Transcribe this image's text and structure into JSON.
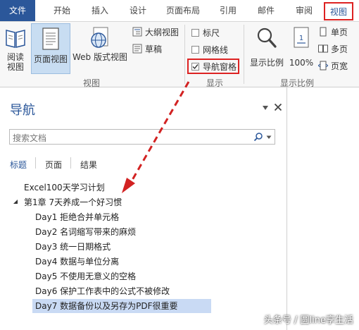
{
  "tabs": [
    "文件",
    "开始",
    "插入",
    "设计",
    "页面布局",
    "引用",
    "邮件",
    "审阅",
    "视图"
  ],
  "ribbon": {
    "view_group": {
      "read_mode": "阅读视图",
      "print_layout": "页面视图",
      "web_layout": "Web 版式视图",
      "outline": "大纲视图",
      "draft": "草稿",
      "label": "视图"
    },
    "show_group": {
      "ruler": "标尺",
      "gridlines": "网格线",
      "nav_pane": "导航窗格",
      "label": "显示"
    },
    "zoom_group": {
      "zoom": "显示比例",
      "zoom100": "100%",
      "one_page": "单页",
      "multi_page": "多页",
      "page_width": "页宽",
      "label": "显示比例"
    }
  },
  "nav": {
    "title": "导航",
    "search_placeholder": "搜索文档",
    "tabs": [
      "标题",
      "页面",
      "结果"
    ],
    "tree": [
      {
        "text": "Excel100天学习计划",
        "level": 0
      },
      {
        "text": "第1章 7天养成一个好习惯",
        "level": 1
      },
      {
        "text": "Day1 拒绝合并单元格",
        "level": 2
      },
      {
        "text": "Day2 名词缩写带来的麻烦",
        "level": 2
      },
      {
        "text": "Day3 统一日期格式",
        "level": 2
      },
      {
        "text": "Day4 数据与单位分离",
        "level": 2
      },
      {
        "text": "Day5 不使用无意义的空格",
        "level": 2
      },
      {
        "text": "Day6 保护工作表中的公式不被修改",
        "level": 2
      },
      {
        "text": "Day7 数据备份以及另存为PDF很重要",
        "level": 2
      }
    ]
  },
  "watermark": "头条号 / 圆line享生活",
  "colors": {
    "accent": "#2b579a",
    "highlight": "#d22222",
    "selection": "#c9daf4"
  }
}
